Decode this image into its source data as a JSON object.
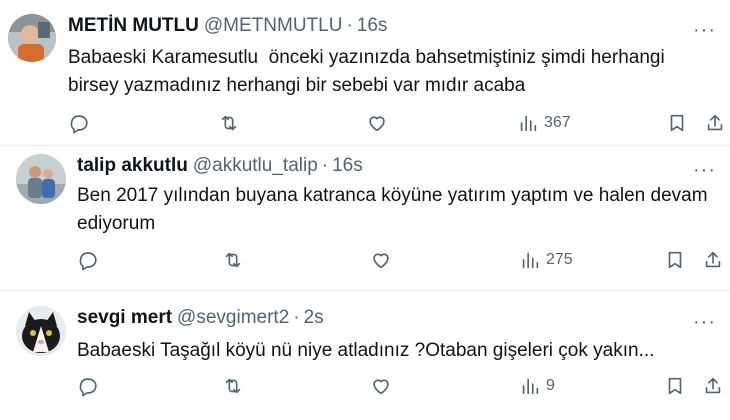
{
  "tweets": [
    {
      "name": "METİN MUTLU",
      "handle": "@METNMUTLU",
      "separator": "·",
      "time": "16s",
      "text": "Babaeski Karamesutlu  önceki yazınızda bahsetmiştiniz şimdi herhangi\nbirsey yazmadınız herhangi bir sebebi var mıdır acaba",
      "views": "367",
      "more": "···"
    },
    {
      "name": "talip akkutlu",
      "handle": "@akkutlu_talip",
      "separator": "·",
      "time": "16s",
      "text": "Ben 2017 yılından buyana katranca köyüne yatırım yaptım ve halen devam\nediyorum",
      "views": "275",
      "more": "···"
    },
    {
      "name": "sevgi mert",
      "handle": "@sevgimert2",
      "separator": "·",
      "time": "2s",
      "text": "Babaeski Taşağıl köyü nü niye atladınız ?Otaban gişeleri çok yakın...",
      "views": "9",
      "more": "···"
    }
  ],
  "icons": {
    "reply": "reply-icon",
    "retweet": "retweet-icon",
    "like": "like-icon",
    "views": "views-icon",
    "bookmark": "bookmark-icon",
    "share": "share-icon"
  },
  "colors": {
    "text": "#0f1419",
    "secondary": "#536471",
    "divider": "#e6ecf0"
  }
}
